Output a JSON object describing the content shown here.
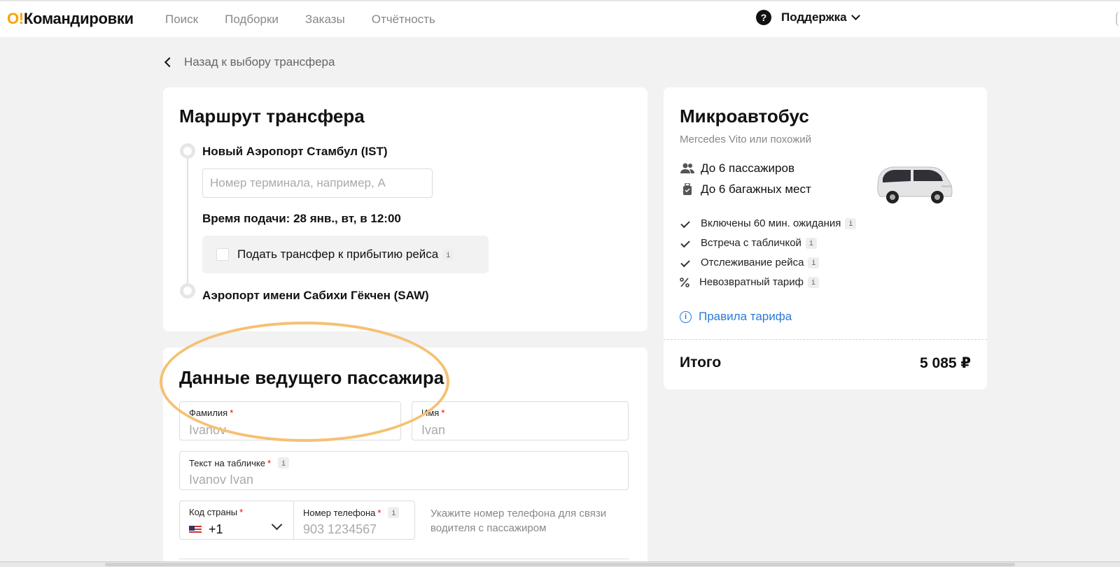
{
  "header": {
    "logo_prefix": "O!",
    "logo_text": "Командировки",
    "nav": [
      "Поиск",
      "Подборки",
      "Заказы",
      "Отчётность"
    ],
    "support_label": "Поддержка"
  },
  "back_link": "Назад к выбору трансфера",
  "route": {
    "title": "Маршрут трансфера",
    "from": "Новый Аэропорт Стамбул (IST)",
    "terminal_placeholder": "Номер терминала, например, A",
    "time_label": "Время подачи: 28 янв., вт, в 12:00",
    "checkbox_label": "Подать трансфер к прибытию рейса",
    "to": "Аэропорт имени Сабихи Гёкчен (SAW)"
  },
  "passenger": {
    "title": "Данные ведущего пассажира",
    "last_name_label": "Фамилия",
    "last_name_value": "Ivanov",
    "first_name_label": "Имя",
    "first_name_value": "Ivan",
    "sign_label": "Текст на табличке",
    "sign_value": "Ivanov Ivan",
    "country_code_label": "Код страны",
    "country_code_value": "+1",
    "phone_label": "Номер телефона",
    "phone_value": "903 1234567",
    "phone_hint": "Укажите номер телефона для связи водителя с пассажиром",
    "required_mark": "*",
    "info_mark": "i"
  },
  "vehicle": {
    "title": "Микроавтобус",
    "subtitle": "Mercedes Vito или похожий",
    "passengers": "До 6 пассажиров",
    "luggage": "До 6 багажных мест",
    "included": [
      "Включены 60 мин. ожидания",
      "Встреча с табличкой",
      "Отслеживание рейса"
    ],
    "non_refundable": "Невозвратный тариф",
    "rules_link": "Правила тарифа",
    "total_label": "Итого",
    "total_value": "5 085 ₽"
  },
  "colors": {
    "brand": "#f7a400",
    "link": "#2b7ad8",
    "highlight": "#f5c173",
    "required": "#e00000"
  }
}
